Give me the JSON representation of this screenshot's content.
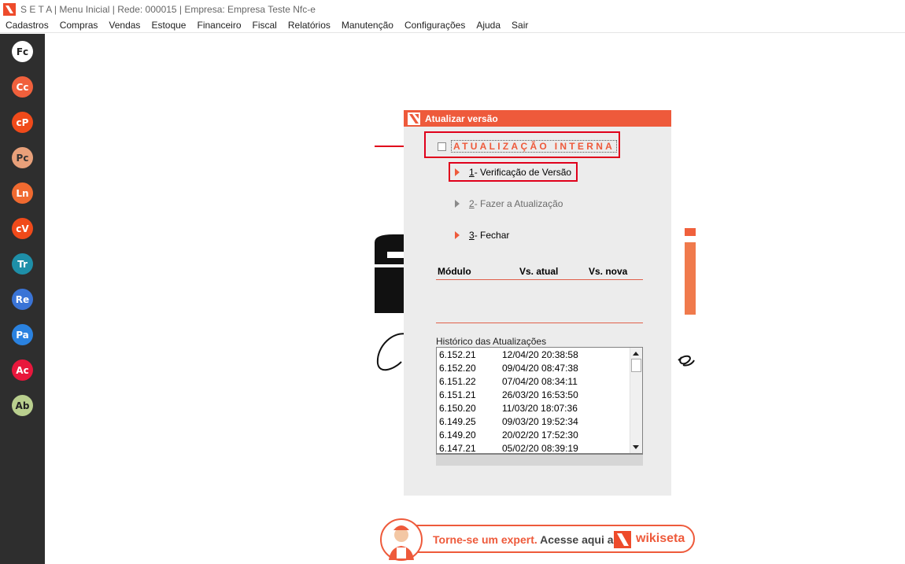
{
  "window": {
    "title": "S E T A | Menu Inicial | Rede: 000015 | Empresa: Empresa Teste Nfc-e"
  },
  "menu": [
    "Cadastros",
    "Compras",
    "Vendas",
    "Estoque",
    "Financeiro",
    "Fiscal",
    "Relatórios",
    "Manutenção",
    "Configurações",
    "Ajuda",
    "Sair"
  ],
  "sidebar": [
    {
      "label": "Fc",
      "color": "#ffffff",
      "text": "#222222"
    },
    {
      "label": "Cc",
      "color": "#f0603c",
      "text": "#ffffff"
    },
    {
      "label": "cP",
      "color": "#f04a1a",
      "text": "#ffffff"
    },
    {
      "label": "Pc",
      "color": "#e8a07a",
      "text": "#333333"
    },
    {
      "label": "Ln",
      "color": "#f06a30",
      "text": "#ffffff"
    },
    {
      "label": "cV",
      "color": "#f04a1a",
      "text": "#ffffff"
    },
    {
      "label": "Tr",
      "color": "#1e8fa8",
      "text": "#ffffff"
    },
    {
      "label": "Re",
      "color": "#3a74d6",
      "text": "#ffffff"
    },
    {
      "label": "Pa",
      "color": "#2a82e0",
      "text": "#ffffff"
    },
    {
      "label": "Ac",
      "color": "#e8173c",
      "text": "#ffffff"
    },
    {
      "label": "Ab",
      "color": "#b9cf8e",
      "text": "#222222"
    }
  ],
  "dialog": {
    "title": "Atualizar versão",
    "checkbox_label": "ATUALIZAÇÃO INTERNA",
    "steps": [
      {
        "num": "1",
        "label": " - Verificação de Versão",
        "enabled": true
      },
      {
        "num": "2",
        "label": " - Fazer a Atualização",
        "enabled": false
      },
      {
        "num": "3",
        "label": " - Fechar",
        "enabled": true
      }
    ],
    "table_headers": {
      "module": "Módulo",
      "current": "Vs. atual",
      "new": "Vs. nova"
    },
    "history_label": "Histórico das Atualizações",
    "history": [
      {
        "version": "6.152.21",
        "date": "12/04/20 20:38:58"
      },
      {
        "version": "6.152.20",
        "date": "09/04/20 08:47:38"
      },
      {
        "version": "6.151.22",
        "date": "07/04/20 08:34:11"
      },
      {
        "version": "6.151.21",
        "date": "26/03/20 16:53:50"
      },
      {
        "version": "6.150.20",
        "date": "11/03/20 18:07:36"
      },
      {
        "version": "6.149.25",
        "date": "09/03/20 19:52:34"
      },
      {
        "version": "6.149.20",
        "date": "20/02/20 17:52:30"
      },
      {
        "version": "6.147.21",
        "date": "05/02/20 08:39:19"
      }
    ]
  },
  "banner": {
    "text1": "Torne-se um expert.",
    "text2": " Acesse aqui a",
    "brand": "wikiseta"
  },
  "colors": {
    "accent": "#ee5a3b",
    "highlight": "#e0001b"
  }
}
